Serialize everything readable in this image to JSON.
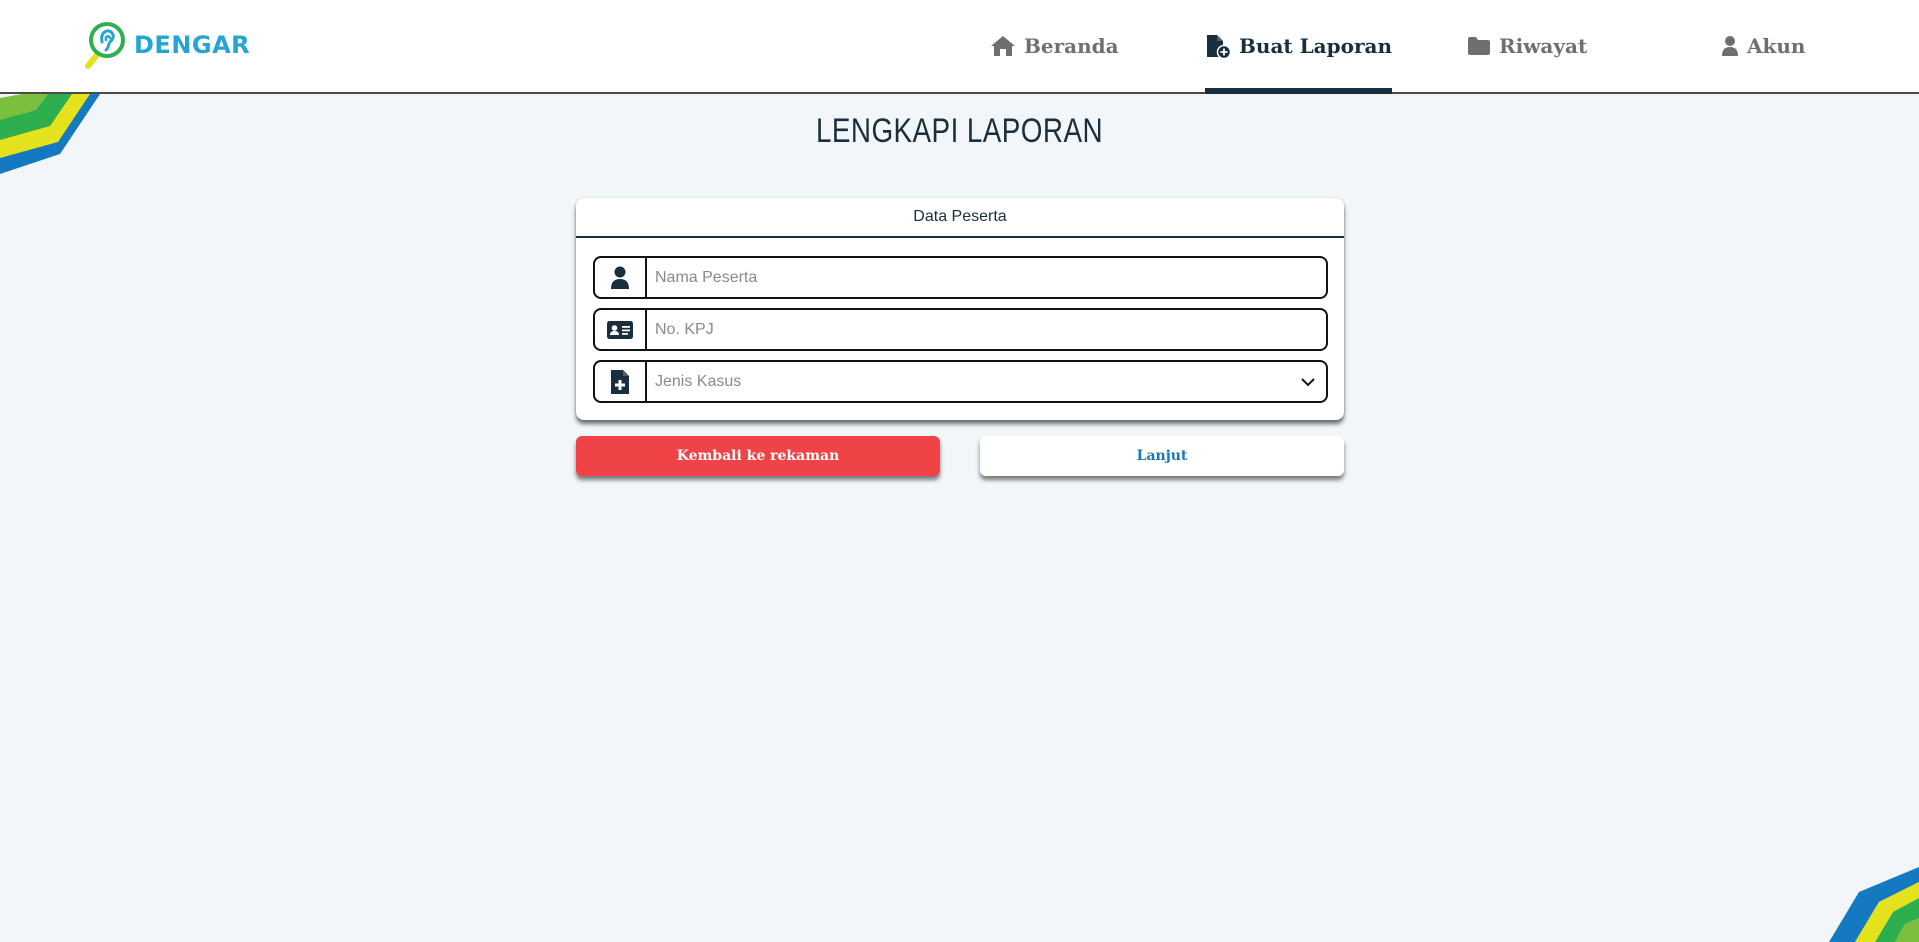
{
  "app": {
    "logo_text": "DENGAR"
  },
  "nav": {
    "items": [
      {
        "label": "Beranda",
        "icon": "home-icon",
        "active": false
      },
      {
        "label": "Buat Laporan",
        "icon": "file-add-icon",
        "active": true
      },
      {
        "label": "Riwayat",
        "icon": "folder-icon",
        "active": false
      },
      {
        "label": "Akun",
        "icon": "user-icon",
        "active": false
      }
    ]
  },
  "page": {
    "title": "LENGKAPI LAPORAN"
  },
  "form": {
    "card_title": "Data Peserta",
    "name_placeholder": "Nama Peserta",
    "kpj_placeholder": "No. KPJ",
    "case_placeholder": "Jenis Kasus"
  },
  "actions": {
    "back_label": "Kembali ke rekaman",
    "next_label": "Lanjut"
  },
  "colors": {
    "primary_dark": "#1a2f3d",
    "logo_blue": "#24a5d4",
    "danger": "#ef4347",
    "link_blue": "#1877b8",
    "background": "#f2f6f9"
  }
}
